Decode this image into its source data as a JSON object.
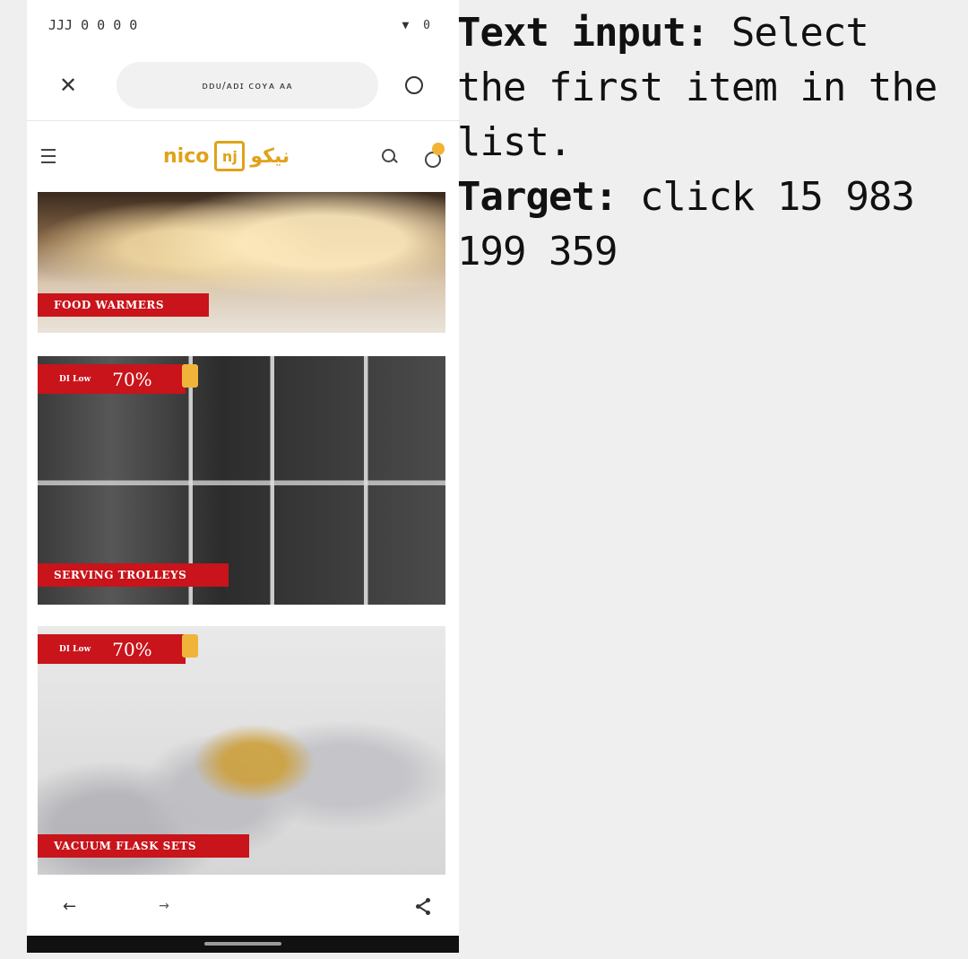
{
  "status_bar": {
    "time": "JJJ 0 0 0 0",
    "icons": "▼ 0"
  },
  "browser": {
    "url": "ᴅᴅᴜ/ᴀᴅɪ ᴄᴏʏᴀ ᴀᴀ"
  },
  "site": {
    "logo_text": "nico",
    "logo_mark": "nj",
    "logo_arabic": "نيكو"
  },
  "tiles": [
    {
      "label": "FOOD WARMERS",
      "offer": null
    },
    {
      "label": "SERVING TROLLEYS",
      "offer": {
        "small": "DI Low",
        "pct": "70%"
      }
    },
    {
      "label": "VACUUM FLASK SETS",
      "offer": {
        "small": "DI Low",
        "pct": "70%"
      }
    }
  ],
  "nav": {
    "back": "←",
    "forward": "→"
  },
  "instruction": {
    "label1": "Text input:",
    "text1": " Select the first item in the list.",
    "label2": "Target:",
    "text2": " click 15 983 199 359"
  },
  "colors": {
    "accent": "#c8141a",
    "brand": "#e0a21a",
    "badge": "#f2b233"
  },
  "icons": [
    "close-icon",
    "reload-icon",
    "menu-icon",
    "search-icon",
    "cart-icon",
    "back-arrow-icon",
    "forward-arrow-icon",
    "share-icon"
  ]
}
